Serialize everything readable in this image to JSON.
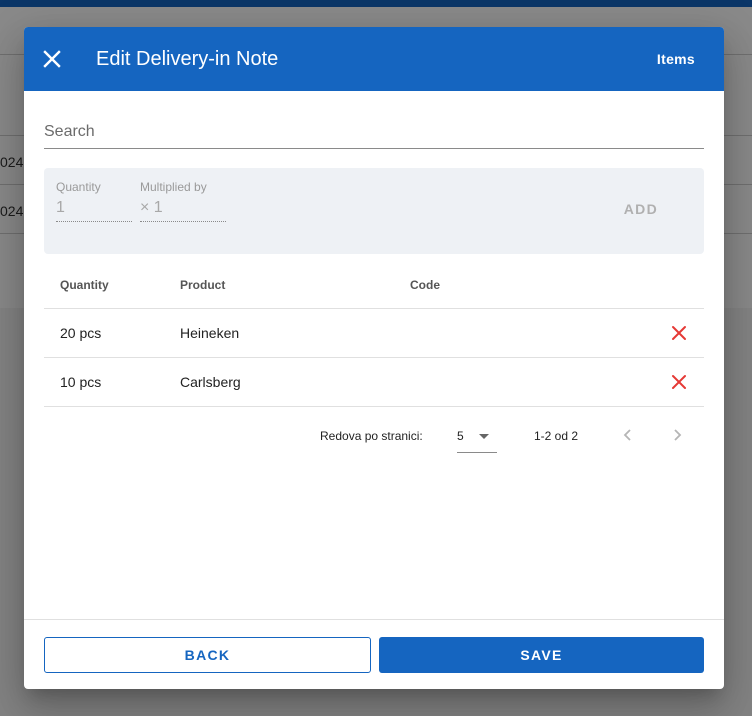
{
  "background": {
    "row_dates": [
      "024.",
      "024."
    ]
  },
  "dialog": {
    "title": "Edit Delivery-in Note",
    "items_link": "Items",
    "close_icon": "close-icon",
    "search": {
      "placeholder": "Search",
      "value": ""
    },
    "add_panel": {
      "quantity_label": "Quantity",
      "quantity_value": "1",
      "multiplier_label": "Multiplied by",
      "multiplier_value": "× 1",
      "add_label": "ADD"
    },
    "table": {
      "headers": {
        "quantity": "Quantity",
        "product": "Product",
        "code": "Code"
      },
      "rows": [
        {
          "quantity": "20 pcs",
          "product": "Heineken",
          "code": ""
        },
        {
          "quantity": "10 pcs",
          "product": "Carlsberg",
          "code": ""
        }
      ],
      "delete_icon": "delete-x-icon"
    },
    "pagination": {
      "rows_per_page_label": "Redova po stranici:",
      "rows_per_page_value": "5",
      "range": "1-2 od 2"
    },
    "footer": {
      "back_label": "BACK",
      "save_label": "SAVE"
    }
  },
  "colors": {
    "primary": "#1565c0",
    "delete": "#e53935",
    "panel_bg": "#eef1f5"
  }
}
